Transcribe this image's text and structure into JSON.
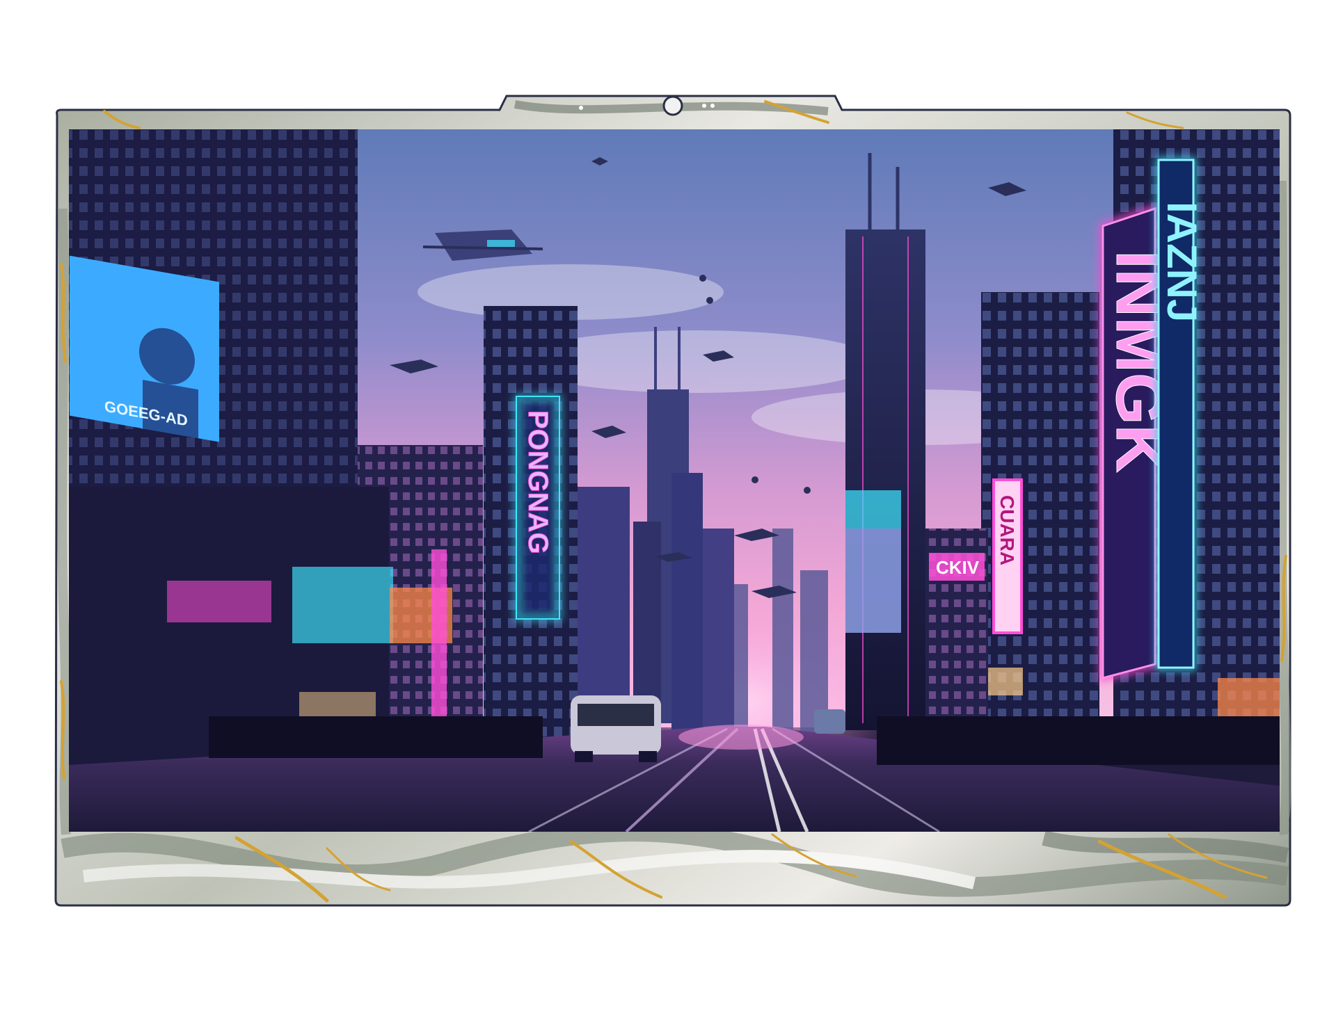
{
  "device": {
    "type": "laptop-lid-skin",
    "bezel_pattern": "grey-white marble with gold veins",
    "colors": {
      "page_background": "#ffffff",
      "bezel_outline": "#2a2f45",
      "marble_light": "#f3f2ef",
      "marble_mid": "#c7c9c0",
      "marble_dark": "#7f8a7d",
      "gold_vein": "#d4a233",
      "screen_frame": "#1e1a3a"
    },
    "camera_notch": {
      "icons": [
        "webcam-icon",
        "indicator-dot-icon"
      ]
    }
  },
  "screen": {
    "scene": "neon cyberpunk city street at dusk with flying vehicles",
    "colors": {
      "sky_top": "#5f7bb8",
      "sky_mid": "#b58ac9",
      "sky_horizon": "#f2a8d6",
      "building_dark": "#1c1d44",
      "building_mid": "#2b2b5c",
      "neon_pink": "#ff4fd8",
      "neon_cyan": "#3fe7ff",
      "neon_blue": "#3b8bff",
      "neon_orange": "#ff8a4a",
      "road": "#2a2344",
      "road_glow": "#8a4fa6"
    },
    "signs": [
      {
        "id": "sign-left-tower",
        "text": "PONGNAG"
      },
      {
        "id": "sign-right-big",
        "text": "INMGK"
      },
      {
        "id": "sign-right-cyan",
        "text": "IAZNJ"
      },
      {
        "id": "sign-right-small",
        "text": "CUARA"
      },
      {
        "id": "sign-right-banner",
        "text": "CKIV"
      },
      {
        "id": "billboard-left",
        "text": "GOEEG-AD"
      }
    ]
  }
}
